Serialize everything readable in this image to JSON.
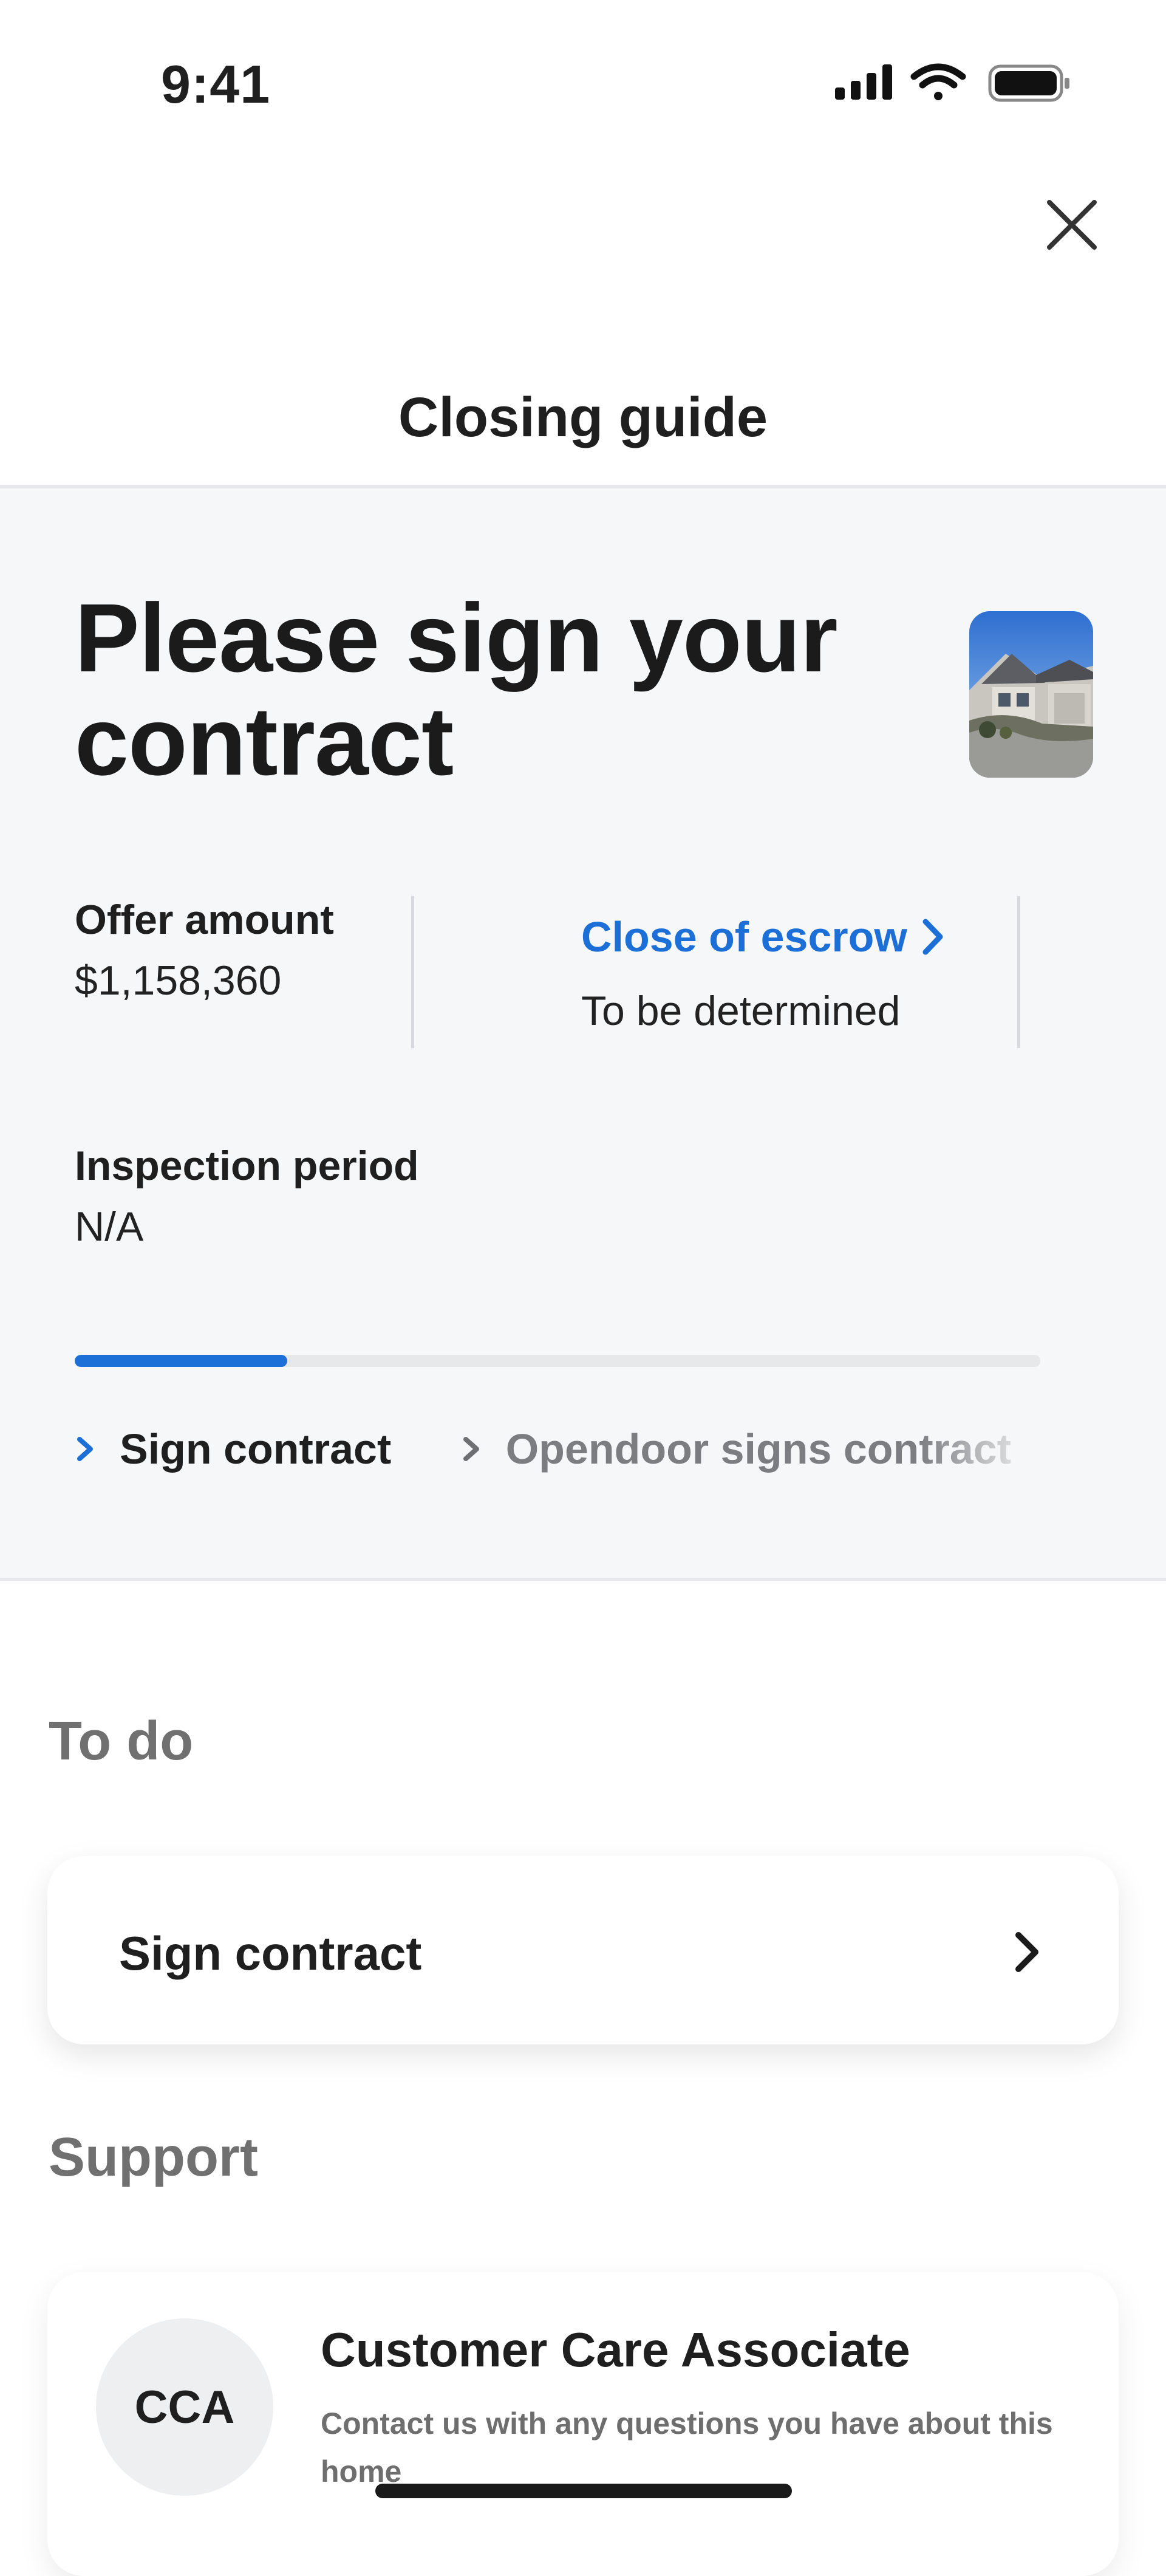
{
  "status_bar": {
    "time": "9:41"
  },
  "nav": {
    "title": "Closing guide"
  },
  "summary": {
    "headline": "Please sign your contract",
    "offer_amount": {
      "label": "Offer amount",
      "value": "$1,158,360"
    },
    "close_of_escrow": {
      "label": "Close of escrow",
      "value": "To be determined"
    },
    "inspection_period": {
      "label": "Inspection period",
      "value": "N/A"
    },
    "progress_fraction": 0.22,
    "steps": [
      {
        "label": "Sign contract",
        "state": "active"
      },
      {
        "label": "Opendoor signs contract",
        "state": "upcoming"
      }
    ]
  },
  "todo": {
    "title": "To do",
    "items": [
      {
        "label": "Sign contract"
      }
    ]
  },
  "support": {
    "title": "Support",
    "contact": {
      "initials": "CCA",
      "name": "Customer Care Associate",
      "description": "Contact us with any questions you have about this home"
    }
  },
  "colors": {
    "accent": "#1d6fd8",
    "background": "#f6f7f8",
    "muted_text": "#707070"
  }
}
